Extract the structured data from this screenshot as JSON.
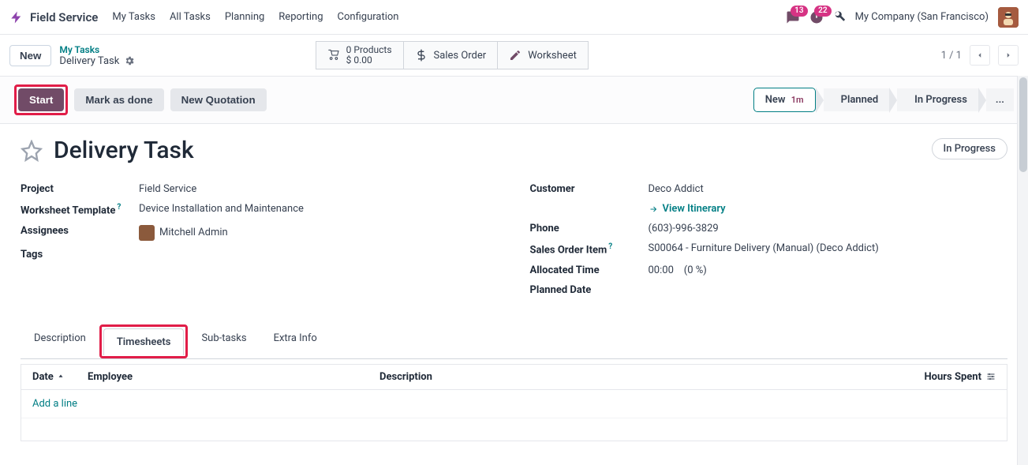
{
  "brand": "Field Service",
  "nav": [
    "My Tasks",
    "All Tasks",
    "Planning",
    "Reporting",
    "Configuration"
  ],
  "notif": {
    "messages": "13",
    "activities": "22"
  },
  "company": "My Company (San Francisco)",
  "control": {
    "new_btn": "New",
    "crumb_parent": "My Tasks",
    "crumb_current": "Delivery Task",
    "products_label": "0 Products",
    "products_amount": "$ 0.00",
    "sales_order_btn": "Sales Order",
    "worksheet_btn": "Worksheet",
    "pager": "1 / 1"
  },
  "actions": {
    "start": "Start",
    "mark_done": "Mark as done",
    "new_quotation": "New Quotation"
  },
  "stages": {
    "new": "New",
    "new_time": "1m",
    "planned": "Planned",
    "in_progress": "In Progress",
    "more": "..."
  },
  "record": {
    "title": "Delivery Task",
    "status_pill": "In Progress",
    "left": {
      "project_label": "Project",
      "project": "Field Service",
      "wtpl_label": "Worksheet Template",
      "wtpl": "Device Installation and Maintenance",
      "assignees_label": "Assignees",
      "assignee": "Mitchell Admin",
      "tags_label": "Tags"
    },
    "right": {
      "customer_label": "Customer",
      "customer": "Deco Addict",
      "itinerary": "View Itinerary",
      "phone_label": "Phone",
      "phone": "(603)-996-3829",
      "soi_label": "Sales Order Item",
      "soi": "S00064 - Furniture Delivery (Manual) (Deco Addict)",
      "alloc_label": "Allocated Time",
      "alloc_time": "00:00",
      "alloc_pct": "(0 %)",
      "planned_label": "Planned Date"
    }
  },
  "tabs": [
    "Description",
    "Timesheets",
    "Sub-tasks",
    "Extra Info"
  ],
  "grid": {
    "cols": {
      "date": "Date",
      "employee": "Employee",
      "description": "Description",
      "hours": "Hours Spent"
    },
    "add_line": "Add a line"
  }
}
